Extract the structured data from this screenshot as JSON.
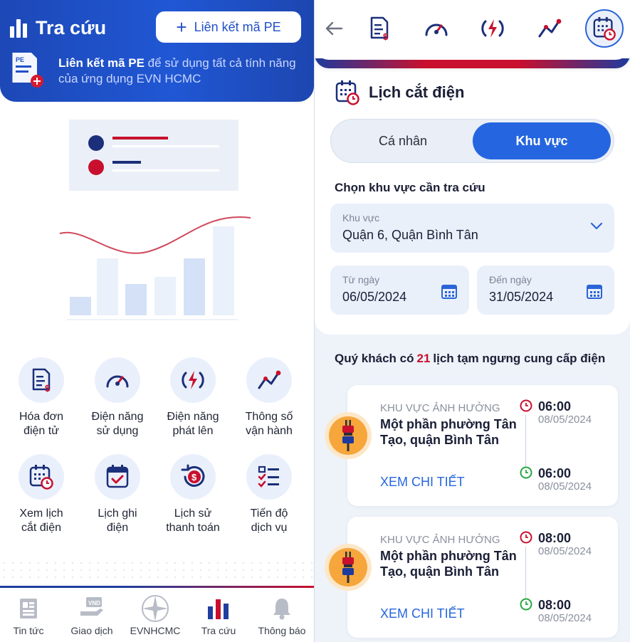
{
  "left": {
    "header": {
      "title": "Tra cứu",
      "link_button": "Liên kết mã PE",
      "note_bold": "Liên kết mã PE",
      "note_rest": " để sử dụng tất cả tính năng của ứng dụng EVN HCMC",
      "pe_badge": "PE"
    },
    "grid": [
      {
        "label": "Hóa đơn\nđiện tử",
        "icon": "bill-icon"
      },
      {
        "label": "Điện năng\nsử dụng",
        "icon": "gauge-icon"
      },
      {
        "label": "Điện năng\nphát lên",
        "icon": "power-icon"
      },
      {
        "label": "Thông số\nvận hành",
        "icon": "line-chart-icon"
      },
      {
        "label": "Xem lịch\ncắt điện",
        "icon": "calendar-clock-icon"
      },
      {
        "label": "Lịch ghi\nđiện",
        "icon": "calendar-check-icon"
      },
      {
        "label": "Lịch sử\nthanh toán",
        "icon": "payment-history-icon"
      },
      {
        "label": "Tiến độ\ndịch vụ",
        "icon": "checklist-icon"
      }
    ],
    "tabbar": [
      {
        "label": "Tin tức",
        "icon": "news-icon"
      },
      {
        "label": "Giao dịch",
        "icon": "transaction-icon"
      },
      {
        "label": "EVNHCMC",
        "icon": "evn-logo-icon"
      },
      {
        "label": "Tra cứu",
        "icon": "lookup-icon",
        "active": true
      },
      {
        "label": "Thông báo",
        "icon": "bell-icon"
      }
    ],
    "vnd_badge": "VND"
  },
  "right": {
    "section_title": "Lịch cắt điện",
    "segment": {
      "personal": "Cá nhân",
      "area": "Khu vực",
      "selected": "area"
    },
    "choose_label": "Chọn khu vực cần tra cứu",
    "area_field": {
      "label": "Khu vực",
      "value": "Quận 6, Quận Bình Tân"
    },
    "from_field": {
      "label": "Từ ngày",
      "value": "06/05/2024"
    },
    "to_field": {
      "label": "Đến ngày",
      "value": "31/05/2024"
    },
    "summary": {
      "prefix": "Quý khách có",
      "count": "21",
      "suffix": "lịch tạm ngưng cung cấp điện"
    },
    "events": [
      {
        "caption": "KHU VỰC ẢNH HƯỞNG",
        "area": "Một phần phường Tân Tạo, quận Bình Tân",
        "more": "XEM CHI TIẾT",
        "start_time": "06:00",
        "start_date": "08/05/2024",
        "end_time": "06:00",
        "end_date": "08/05/2024"
      },
      {
        "caption": "KHU VỰC ẢNH HƯỞNG",
        "area": "Một phần phường Tân Tạo, quận Bình Tân",
        "more": "XEM CHI TIẾT",
        "start_time": "08:00",
        "start_date": "08/05/2024",
        "end_time": "08:00",
        "end_date": "08/05/2024"
      }
    ]
  },
  "colors": {
    "primary": "#2566e0",
    "brand_red": "#c8102e",
    "brand_navy": "#1d3a9e"
  }
}
